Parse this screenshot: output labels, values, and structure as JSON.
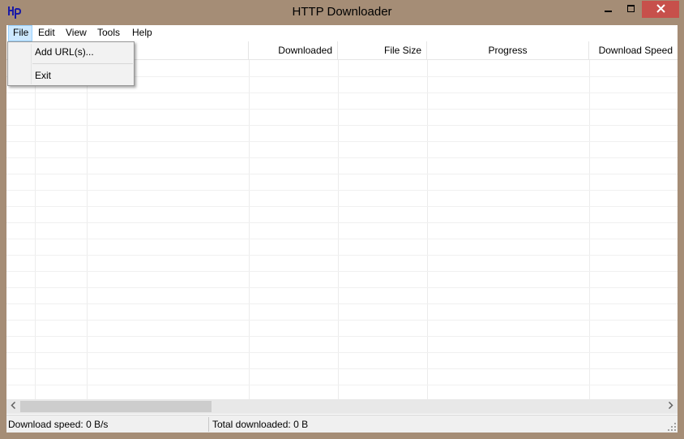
{
  "window": {
    "title": "HTTP Downloader"
  },
  "menubar": {
    "file": "File",
    "edit": "Edit",
    "view": "View",
    "tools": "Tools",
    "help": "Help"
  },
  "file_menu": {
    "add_urls": "Add URL(s)...",
    "exit": "Exit"
  },
  "list": {
    "columns": [
      "Downloaded",
      "File Size",
      "Progress",
      "Download Speed"
    ],
    "rows": []
  },
  "statusbar": {
    "download_speed": "Download speed: 0 B/s",
    "total_downloaded": "Total downloaded: 0 B"
  },
  "colors": {
    "frame": "#a58d76",
    "close_button": "#c7504b",
    "menu_highlight": "#cce8ff",
    "icon_blue": "#1a1aa6"
  },
  "icons": {
    "app": "hd-logo-icon",
    "minimize": "minimize-icon",
    "maximize": "maximize-icon",
    "close": "close-icon",
    "scroll_left": "chevron-left-icon",
    "scroll_right": "chevron-right-icon",
    "grip": "resize-grip-icon"
  }
}
